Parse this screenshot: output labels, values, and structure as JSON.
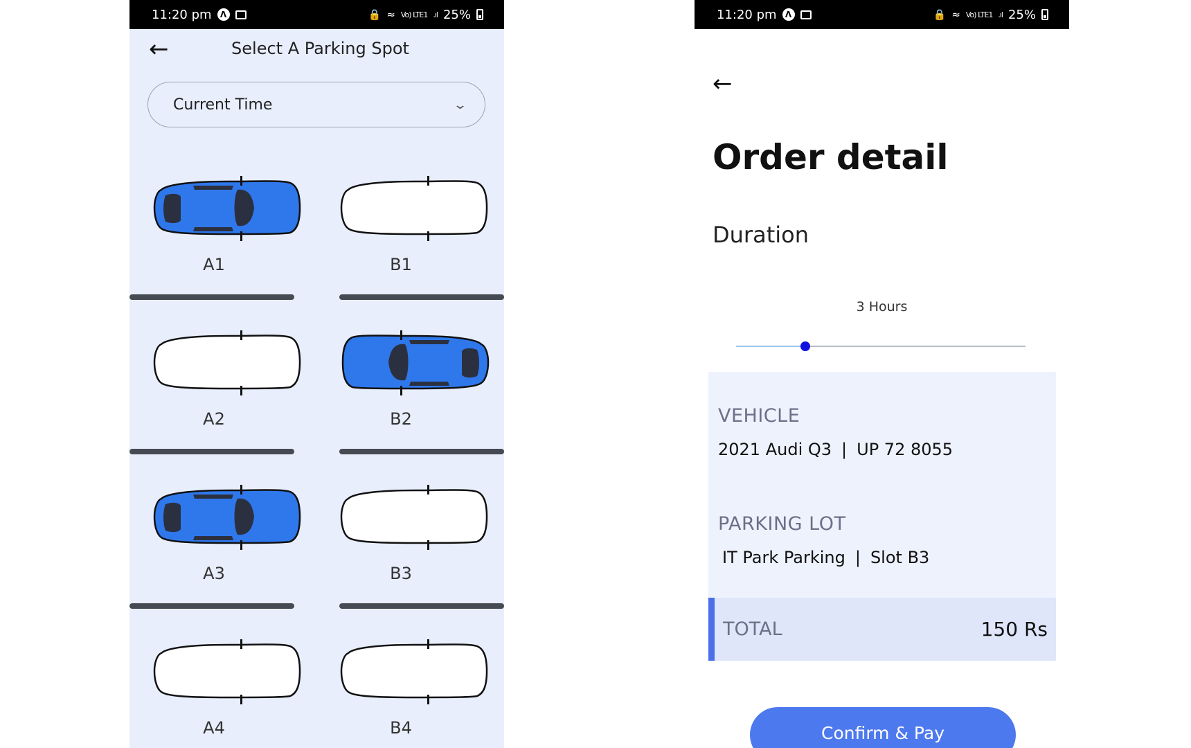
{
  "left_screen": {
    "status_bar": {
      "time": "11:20 pm",
      "battery": "25%",
      "network": "Vo) LTE1"
    },
    "header": {
      "title": "Select A Parking Spot"
    },
    "time_select": {
      "value": "Current Time"
    },
    "spots": [
      {
        "label": "A1",
        "occupied": true
      },
      {
        "label": "B1",
        "occupied": false
      },
      {
        "label": "A2",
        "occupied": false
      },
      {
        "label": "B2",
        "occupied": true
      },
      {
        "label": "A3",
        "occupied": true
      },
      {
        "label": "B3",
        "occupied": false
      },
      {
        "label": "A4",
        "occupied": false
      },
      {
        "label": "B4",
        "occupied": false
      }
    ],
    "colors": {
      "background": "#e8eefc",
      "car_occupied": "#2f78ec",
      "car_empty": "#ffffff",
      "divider": "#464a52"
    }
  },
  "right_screen": {
    "status_bar": {
      "time": "11:20 pm",
      "battery": "25%",
      "network": "Vo) LTE1"
    },
    "title": "Order detail",
    "duration": {
      "label": "Duration",
      "value_text": "3 Hours",
      "slider_fraction": 0.24
    },
    "vehicle": {
      "label": "VEHICLE",
      "model": "2021 Audi Q3",
      "separator": "|",
      "plate": "UP 72 8055"
    },
    "parking_lot": {
      "label": "PARKING LOT",
      "name": "IT Park Parking",
      "separator": "|",
      "slot": "Slot B3"
    },
    "total": {
      "label": "TOTAL",
      "value": "150 Rs"
    },
    "confirm_button": "Confirm & Pay",
    "colors": {
      "accent": "#4d79ee",
      "slider_thumb": "#1010e0",
      "card_bg": "#eef2fd",
      "total_bg": "#dfe6fa"
    }
  }
}
